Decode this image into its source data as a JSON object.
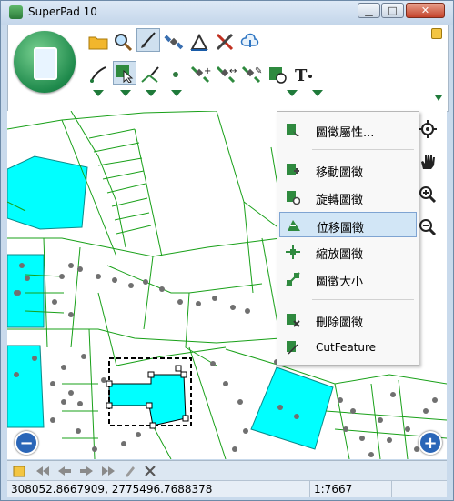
{
  "window": {
    "title": "SuperPad 10",
    "controls": {
      "minimize": "▁",
      "maximize": "□",
      "close": "✕"
    }
  },
  "toolbar": {
    "row1_icons": [
      "folder-icon",
      "magnifier-icon",
      "pen-icon",
      "satellite-icon",
      "measure-icon",
      "tools-icon",
      "cloud-icon"
    ],
    "row2_icons": [
      "draw-icon",
      "select-icon",
      "edit-line-icon",
      "point-icon",
      "gps-add-icon",
      "gps-move-icon",
      "gps-edit-icon",
      "feature-edit-icon",
      "text-icon"
    ]
  },
  "context_menu": {
    "items": [
      {
        "label": "圖徵屬性...",
        "icon": "feature-properties-icon"
      },
      {
        "label": "移動圖徵",
        "icon": "move-feature-icon"
      },
      {
        "label": "旋轉圖徵",
        "icon": "rotate-feature-icon"
      },
      {
        "label": "位移圖徵",
        "icon": "offset-feature-icon",
        "highlighted": true
      },
      {
        "label": "縮放圖徵",
        "icon": "scale-feature-icon"
      },
      {
        "label": "圖徵大小",
        "icon": "resize-feature-icon"
      },
      {
        "label": "刪除圖徵",
        "icon": "delete-feature-icon"
      },
      {
        "label": "CutFeature",
        "icon": "cut-feature-icon"
      }
    ]
  },
  "map_controls": {
    "zoom_out": "−",
    "zoom_in": "+"
  },
  "status": {
    "coordinates": "308052.8667909, 2775496.7688378",
    "scale": "1:7667"
  },
  "colors": {
    "parcel_line": "#18a018",
    "polygon_fill": "#00ffff",
    "point": "#707070"
  }
}
